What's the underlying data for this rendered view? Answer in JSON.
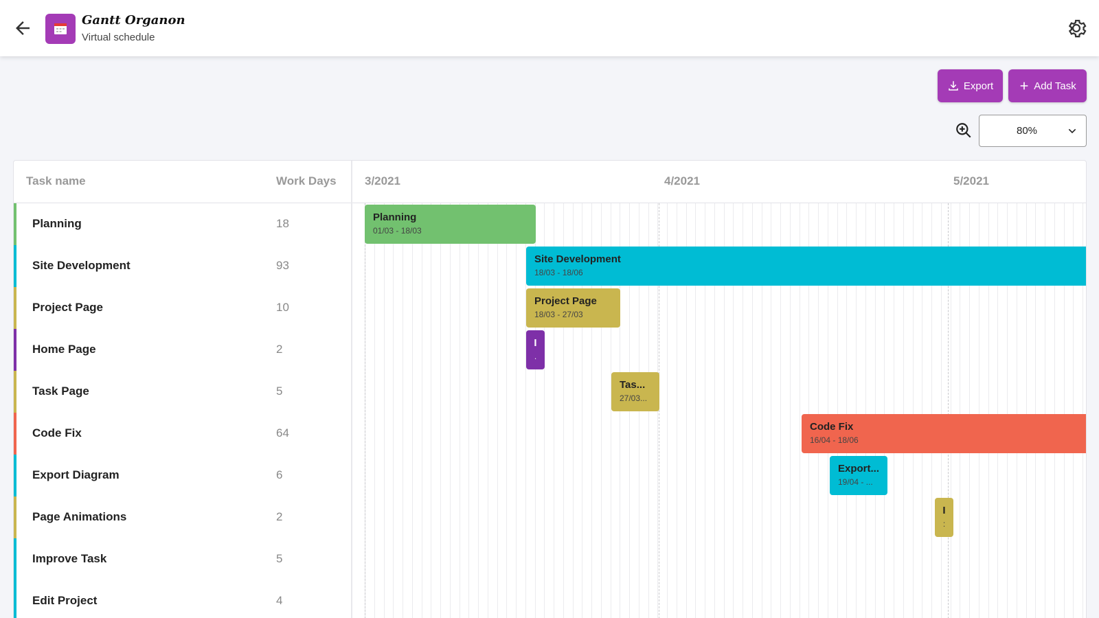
{
  "header": {
    "title": "Gantt Organon",
    "subtitle": "Virtual schedule",
    "back_icon": "arrow-left-icon",
    "app_icon": "calendar-icon",
    "settings_icon": "gear-icon"
  },
  "toolbar": {
    "export_label": "Export",
    "add_task_label": "Add Task",
    "zoom_value": "80%",
    "accent_color": "#a43bb6"
  },
  "grid": {
    "col_task_name": "Task name",
    "col_work_days": "Work Days"
  },
  "timeline": {
    "months": [
      "3/2021",
      "4/2021",
      "5/2021"
    ]
  },
  "tasks": [
    {
      "name": "Planning",
      "days": "18",
      "color": "#72c16f",
      "bar_label": "Planning",
      "bar_date": "01/03 - 18/03"
    },
    {
      "name": "Site Development",
      "days": "93",
      "color": "#00bcd4",
      "bar_label": "Site Development",
      "bar_date": "18/03 - 18/06"
    },
    {
      "name": "Project Page",
      "days": "10",
      "color": "#c9b64f",
      "bar_label": "Project Page",
      "bar_date": "18/03 - 27/03"
    },
    {
      "name": "Home Page",
      "days": "2",
      "color": "#7e30a8",
      "bar_label": "I",
      "bar_date": "."
    },
    {
      "name": "Task Page",
      "days": "5",
      "color": "#c9b64f",
      "bar_label": "Tas...",
      "bar_date": "27/03..."
    },
    {
      "name": "Code Fix",
      "days": "64",
      "color": "#f0654e",
      "bar_label": "Code Fix",
      "bar_date": "16/04 - 18/06"
    },
    {
      "name": "Export Diagram",
      "days": "6",
      "color": "#00bcd4",
      "bar_label": "Export...",
      "bar_date": "19/04 - ..."
    },
    {
      "name": "Page Animations",
      "days": "2",
      "color": "#c9b64f",
      "bar_label": "I",
      "bar_date": ":"
    },
    {
      "name": "Improve Task",
      "days": "5",
      "color": "#00bcd4"
    },
    {
      "name": "Edit Project",
      "days": "4",
      "color": "#00bcd4"
    }
  ]
}
